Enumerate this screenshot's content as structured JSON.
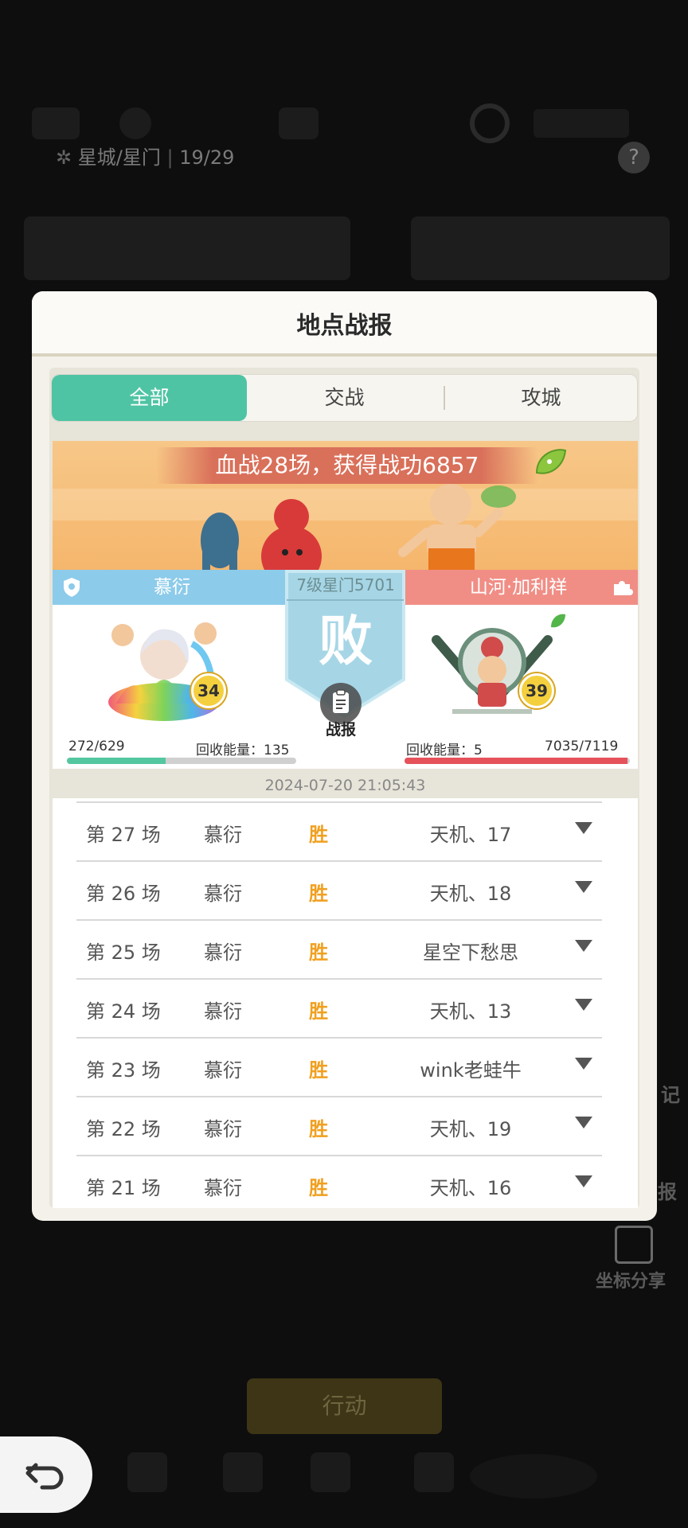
{
  "background": {
    "location": "星城/星门",
    "location_count": "19/29",
    "help_symbol": "?",
    "side_label_1": "记",
    "side_label_2": "报",
    "coord_share": "坐标分享",
    "action_button": "行动"
  },
  "modal": {
    "title": "地点战报",
    "tabs": [
      {
        "label": "全部",
        "active": true
      },
      {
        "label": "交战",
        "active": false
      },
      {
        "label": "攻城",
        "active": false
      }
    ],
    "banner_text": "血战28场，获得战功6857",
    "location_label": "7级星门5701",
    "result": "败",
    "report_label": "战报",
    "left": {
      "name": "慕衍",
      "level": "34",
      "hp": "272/629",
      "hp_fraction": 0.43,
      "recycle": "回收能量：135",
      "bar_color": "#54c7a0"
    },
    "right": {
      "name": "山河·加利祥",
      "level": "39",
      "hp": "7035/7119",
      "hp_fraction": 0.99,
      "recycle": "回收能量：5",
      "bar_color": "#e5525a"
    },
    "timestamp": "2024-07-20 21:05:43",
    "rows": [
      {
        "round": "第 27 场",
        "name": "慕衍",
        "result": "胜",
        "opponent": "天机、17"
      },
      {
        "round": "第 26 场",
        "name": "慕衍",
        "result": "胜",
        "opponent": "天机、18"
      },
      {
        "round": "第 25 场",
        "name": "慕衍",
        "result": "胜",
        "opponent": "星空下愁思"
      },
      {
        "round": "第 24 场",
        "name": "慕衍",
        "result": "胜",
        "opponent": "天机、13"
      },
      {
        "round": "第 23 场",
        "name": "慕衍",
        "result": "胜",
        "opponent": "wink老蛙牛"
      },
      {
        "round": "第 22 场",
        "name": "慕衍",
        "result": "胜",
        "opponent": "天机、19"
      },
      {
        "round": "第 21 场",
        "name": "慕衍",
        "result": "胜",
        "opponent": "天机、16"
      }
    ]
  },
  "colors": {
    "accent_tab": "#4fc4a4",
    "win": "#f0a020",
    "left_team": "#8ccbea",
    "right_team": "#f08e86"
  }
}
